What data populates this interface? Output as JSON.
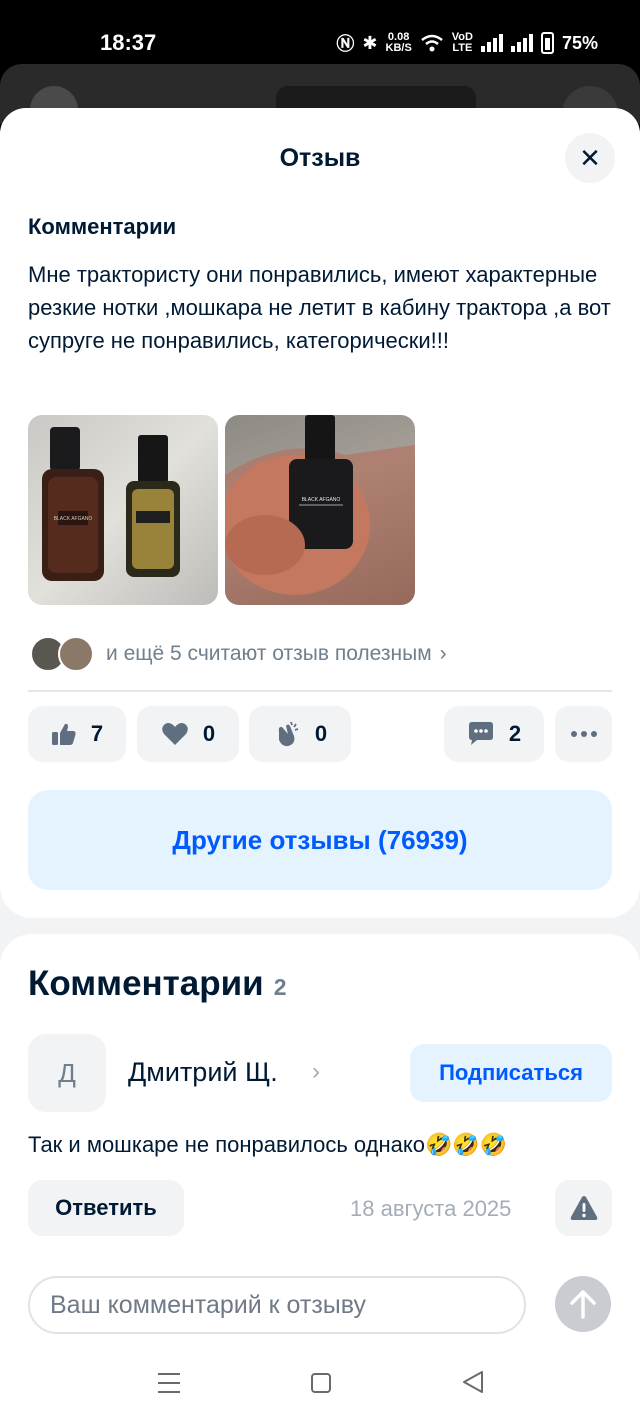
{
  "status_bar": {
    "time": "18:37",
    "net_speed": "0.08",
    "net_unit": "KB/S",
    "volte_top": "VoD",
    "volte_bottom": "LTE",
    "battery": "75%"
  },
  "sheet": {
    "title": "Отзыв",
    "close_icon": "close-icon"
  },
  "review": {
    "section_title": "Комментарии",
    "text": "Мне трактористу они понравились, имеют характерные резкие нотки ,мошкара не летит в кабину  трактора ,а  вот супруге не понравились, категорически!!!",
    "photos": [
      {
        "label": "BLACK AFGANO"
      },
      {
        "label": "BLACK AFGANO"
      }
    ],
    "helpful_text": "и ещё 5 считают отзыв полезным",
    "reactions": {
      "like_count": "7",
      "heart_count": "0",
      "clap_count": "0",
      "comment_count": "2"
    },
    "other_reviews_label": "Другие отзывы (76939)"
  },
  "comments": {
    "title": "Комментарии",
    "count": "2",
    "items": [
      {
        "avatar_letter": "Д",
        "author": "Дмитрий Щ.",
        "subscribe_label": "Подписаться",
        "text": "Так и мошкаре не понравилось однако🤣🤣🤣",
        "reply_label": "Ответить",
        "date": "18 августа 2025"
      }
    ]
  },
  "input": {
    "placeholder": "Ваш комментарий к отзыву"
  },
  "colors": {
    "accent": "#005bff",
    "accent_bg": "#e5f3ff",
    "text": "#001a34",
    "muted": "#707f8d"
  }
}
